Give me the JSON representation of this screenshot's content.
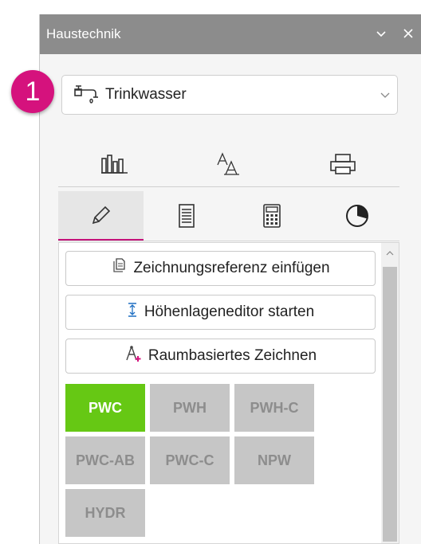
{
  "panel": {
    "title": "Haustechnik",
    "minimize_icon": "chevron-down-icon",
    "close_icon": "close-icon"
  },
  "badge": {
    "number": "1",
    "color": "#d5127d"
  },
  "discipline": {
    "selected": "Trinkwasser",
    "icon": "faucet-icon"
  },
  "top_tabs": [
    {
      "name": "building-stats-icon"
    },
    {
      "name": "text-style-icon"
    },
    {
      "name": "printer-icon"
    }
  ],
  "mode_tabs": [
    {
      "name": "pencil-icon",
      "active": true
    },
    {
      "name": "list-icon"
    },
    {
      "name": "calculator-icon"
    },
    {
      "name": "pie-chart-icon"
    }
  ],
  "actions": [
    {
      "label": "Zeichnungsreferenz einfügen",
      "icon": "reference-insert-icon"
    },
    {
      "label": "Höhenlageneditor starten",
      "icon": "height-editor-icon"
    },
    {
      "label": "Raumbasiertes Zeichnen",
      "icon": "room-draw-icon"
    }
  ],
  "systems": [
    {
      "label": "PWC",
      "active": true
    },
    {
      "label": "PWH"
    },
    {
      "label": "PWH-C"
    },
    {
      "label": "PWC-AB"
    },
    {
      "label": "PWC-C"
    },
    {
      "label": "NPW"
    },
    {
      "label": "HYDR"
    }
  ],
  "colors": {
    "accent": "#c4127a",
    "active_system": "#66c814",
    "inactive_system": "#c6c6c6",
    "titlebar": "#8c8c8c"
  }
}
